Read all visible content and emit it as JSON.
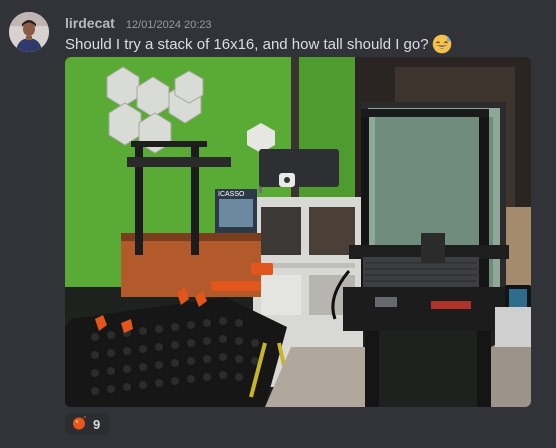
{
  "message": {
    "author": "lirdecat",
    "timestamp": "12/01/2024 20:23",
    "text": "Should I try a stack of 16x16, and how tall should I go?",
    "inline_emoji": "sweat-smile-emoji",
    "avatar_icon": "user-avatar",
    "attachment": {
      "kind": "photo",
      "subject": "3d-printer-and-printed-parts",
      "caption_text": "ICASSO"
    },
    "reactions": [
      {
        "emoji": "orange-dot-emoji",
        "count": "9"
      }
    ]
  },
  "colors": {
    "background": "#313338",
    "username": "#b5bac1",
    "timestamp": "#949ba4",
    "text": "#dbdee1",
    "reaction_bg": "#2b2d31"
  }
}
